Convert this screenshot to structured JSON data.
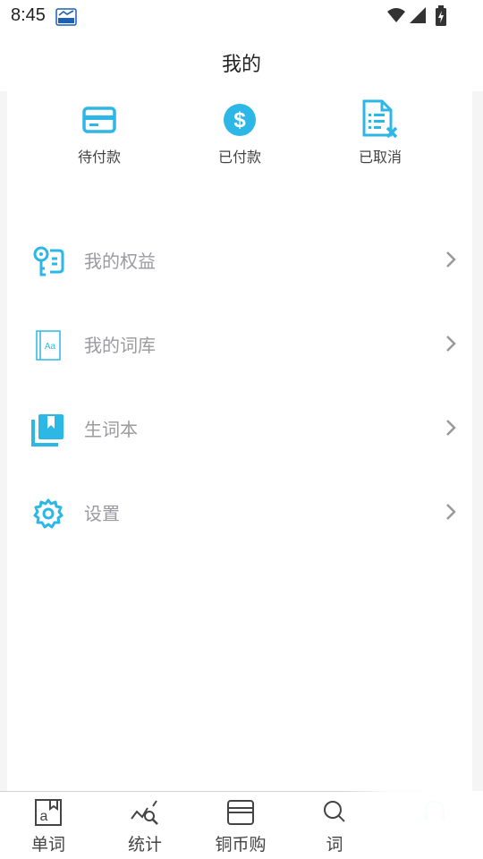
{
  "status_bar": {
    "time": "8:45"
  },
  "header": {
    "title": "我的"
  },
  "orders": [
    {
      "label": "待付款",
      "icon": "card-icon"
    },
    {
      "label": "已付款",
      "icon": "dollar-circle-icon"
    },
    {
      "label": "已取消",
      "icon": "document-cancel-icon"
    }
  ],
  "menu": [
    {
      "label": "我的权益",
      "icon": "key-icon"
    },
    {
      "label": "我的词库",
      "icon": "book-aa-icon"
    },
    {
      "label": "生词本",
      "icon": "bookmark-stack-icon"
    },
    {
      "label": "设置",
      "icon": "gear-icon"
    }
  ],
  "tabbar": [
    {
      "label": "单词",
      "icon": "word-book-icon"
    },
    {
      "label": "统计",
      "icon": "chart-search-icon"
    },
    {
      "label": "铜币购",
      "icon": "wallet-icon"
    },
    {
      "label": "词",
      "icon": "search-icon"
    },
    {
      "label": "",
      "icon": "headset-icon",
      "active": true
    }
  ],
  "colors": {
    "accent": "#2cb7e6",
    "menu_text": "#9a9aa0",
    "background": "#f5f5f5"
  }
}
